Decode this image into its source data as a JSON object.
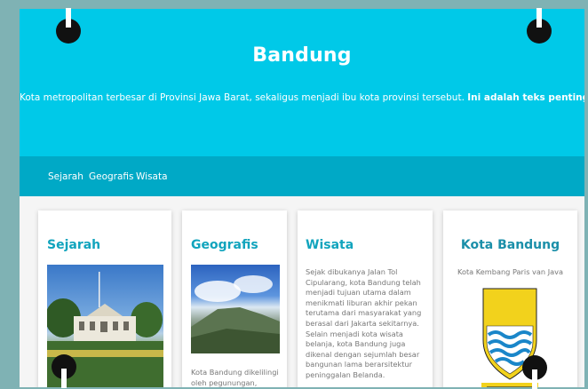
{
  "header": {
    "title": "Bandung",
    "tagline": "Kota metropolitan terbesar di Provinsi Jawa Barat, sekaligus menjadi ibu kota provinsi tersebut.",
    "tagline_bold": "Ini adalah teks penting."
  },
  "nav": {
    "items": [
      "Sejarah",
      "Geografis",
      "Wisata"
    ]
  },
  "cards": {
    "sejarah": {
      "title": "Sejarah"
    },
    "geografis": {
      "title": "Geografis",
      "text": "Kota Bandung dikelilingi oleh pegunungan, sehingga"
    },
    "wisata": {
      "title": "Wisata",
      "text": "Sejak dibukanya Jalan Tol Cipularang, kota Bandung telah menjadi tujuan utama dalam menikmati liburan akhir pekan terutama dari masyarakat yang berasal dari Jakarta sekitarnya. Selain menjadi kota wisata belanja, kota Bandung juga dikenal dengan sejumlah besar bangunan lama berarsitektur peninggalan Belanda."
    },
    "kota": {
      "title": "Kota Bandung",
      "subtitle": "Kota Kembang Paris van Java"
    }
  },
  "colors": {
    "header_bg": "#00c9e8",
    "nav_bg": "#00a9c6",
    "page_bg": "#7fb2b4"
  }
}
